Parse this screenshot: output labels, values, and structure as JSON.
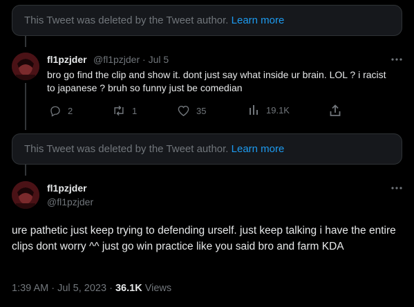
{
  "deleted_notice": {
    "text": "This Tweet was deleted by the Tweet author.",
    "link": "Learn more"
  },
  "reply_tweet": {
    "display_name": "fl1pzjder",
    "handle": "@fl1pzjder",
    "separator": "·",
    "date": "Jul 5",
    "text": "bro go find the clip and show it. dont just say what inside ur brain. LOL ? i racist to japanese ? bruh so funny just be comedian",
    "actions": {
      "replies": "2",
      "retweets": "1",
      "likes": "35",
      "views": "19.1K"
    }
  },
  "main_tweet": {
    "display_name": "fl1pzjder",
    "handle": "@fl1pzjder",
    "text": "ure pathetic just keep trying to defending urself. just keep talking i have the entire clips dont worry ^^ just go win practice like you said bro and farm KDA",
    "time": "1:39 AM",
    "date": "Jul 5, 2023",
    "separator": "·",
    "views_count": "36.1K",
    "views_label": "Views"
  },
  "colors": {
    "background": "#000000",
    "text": "#e7e9ea",
    "muted": "#71767b",
    "link": "#1d9bf0",
    "notice_bg": "#16181c",
    "border": "#2f3336"
  },
  "icons": {
    "more": "more-horizontal-icon",
    "reply": "reply-bubble-icon",
    "retweet": "retweet-icon",
    "like": "heart-icon",
    "views": "analytics-bars-icon",
    "share": "share-upload-icon"
  }
}
